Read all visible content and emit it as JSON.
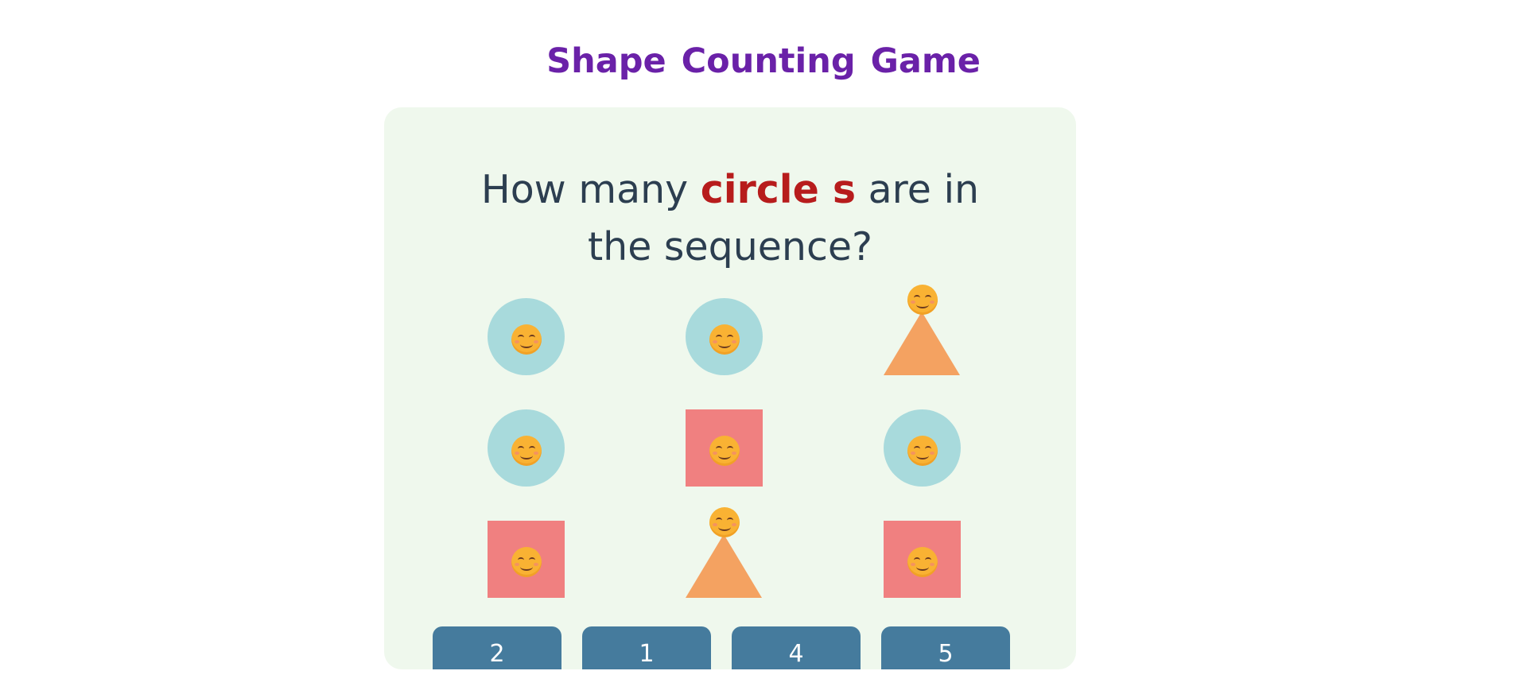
{
  "game": {
    "title": "Shape Counting Game"
  },
  "question": {
    "prefix": "How many",
    "target_shape": "circle s",
    "suffix": "are in the sequence?"
  },
  "shapes": [
    {
      "type": "circle",
      "icon": "smiling-face-icon"
    },
    {
      "type": "circle",
      "icon": "smiling-face-icon"
    },
    {
      "type": "triangle",
      "icon": "smiling-face-icon"
    },
    {
      "type": "circle",
      "icon": "smiling-face-icon"
    },
    {
      "type": "square",
      "icon": "smiling-face-icon"
    },
    {
      "type": "circle",
      "icon": "smiling-face-icon"
    },
    {
      "type": "square",
      "icon": "smiling-face-icon"
    },
    {
      "type": "triangle",
      "icon": "smiling-face-icon"
    },
    {
      "type": "square",
      "icon": "smiling-face-icon"
    }
  ],
  "answers": [
    "2",
    "1",
    "4",
    "5"
  ],
  "colors": {
    "title": "#6a21a8",
    "target_word": "#b71c1c",
    "panel_background": "#eff8ed",
    "circle": "#a8dadc",
    "square": "#f08080",
    "triangle": "#f4a261",
    "answer_button": "#457b9d"
  }
}
